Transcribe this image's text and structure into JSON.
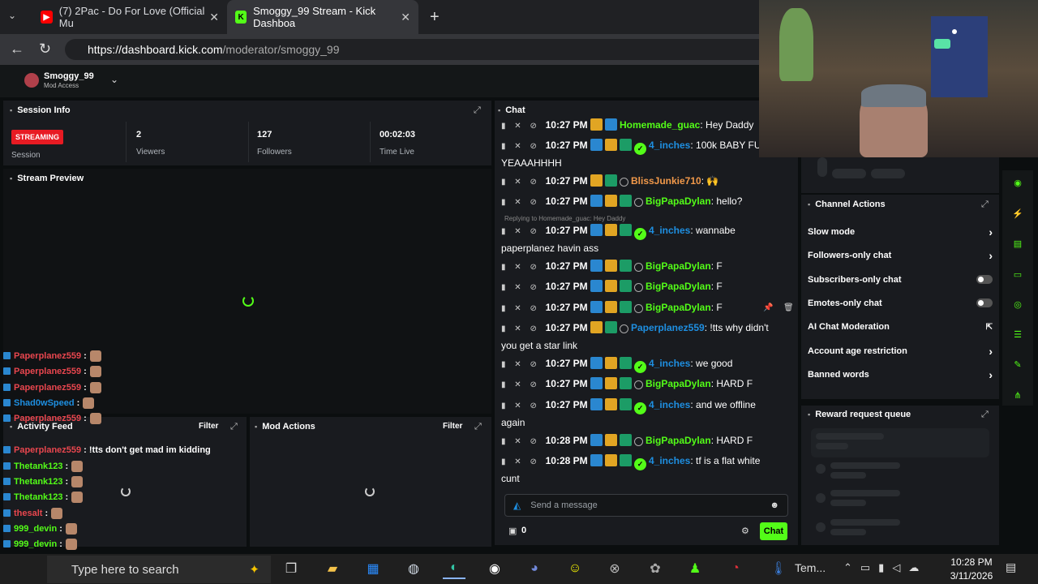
{
  "browser": {
    "tabs": [
      {
        "title": "(7) 2Pac - Do For Love (Official Mu",
        "favicon": "youtube-icon",
        "color": "#ff0000"
      },
      {
        "title": "Smoggy_99 Stream - Kick Dashboa",
        "favicon": "kick-icon",
        "color": "#53fc18"
      }
    ],
    "url_domain": "https://dashboard.kick.com",
    "url_path": "/moderator/smoggy_99"
  },
  "header": {
    "channel": "Smoggy_99",
    "access": "Mod Access"
  },
  "session": {
    "title": "Session Info",
    "status": "STREAMING",
    "status_label": "Session",
    "viewers_value": "2",
    "viewers_label": "Viewers",
    "followers_value": "127",
    "followers_label": "Followers",
    "time_value": "00:02:03",
    "time_label": "Time Live"
  },
  "preview": {
    "title": "Stream Preview"
  },
  "activity": {
    "title": "Activity Feed",
    "filter": "Filter"
  },
  "mod": {
    "title": "Mod Actions",
    "filter": "Filter"
  },
  "overlay_feed": [
    {
      "user": "Paperplanez559",
      "color": "#e8464e",
      "text": ":"
    },
    {
      "user": "Paperplanez559",
      "color": "#e8464e",
      "text": ":"
    },
    {
      "user": "Paperplanez559",
      "color": "#e8464e",
      "text": ":"
    },
    {
      "user": "Shad0wSpeed",
      "color": "#1e8fe1",
      "text": ":"
    },
    {
      "user": "Paperplanez559",
      "color": "#e8464e",
      "text": ":"
    },
    {
      "user": "Paperplanez559",
      "color": "#e8464e",
      "text": ": !tts don't get mad im kidding"
    },
    {
      "user": "Thetank123",
      "color": "#53fc18",
      "text": ":"
    },
    {
      "user": "Thetank123",
      "color": "#53fc18",
      "text": ":"
    },
    {
      "user": "Thetank123",
      "color": "#53fc18",
      "text": ":"
    },
    {
      "user": "thesalt",
      "color": "#e8464e",
      "text": ":"
    },
    {
      "user": "999_devin",
      "color": "#53fc18",
      "text": ":"
    },
    {
      "user": "999_devin",
      "color": "#53fc18",
      "text": ":"
    },
    {
      "user": "999_devin",
      "color": "#53fc18",
      "text": ":"
    },
    {
      "user": "thesalt",
      "color": "#e8464e",
      "text": ":"
    }
  ],
  "chat": {
    "title": "Chat",
    "reply_note": "Replying to Homemade_guac: Hey Daddy",
    "messages": [
      {
        "time": "10:27 PM",
        "user": "Homemade_guac",
        "color": "#53fc18",
        "text": ": Hey Daddy",
        "cont": ""
      },
      {
        "time": "10:27 PM",
        "user": "4_inches",
        "color": "#1e8fe1",
        "text": ": 100k BABY FU",
        "cont": "YEAAAHHHH"
      },
      {
        "time": "10:27 PM",
        "user": "BlissJunkie710",
        "color": "#f2994a",
        "text": ":",
        "cont": ""
      },
      {
        "time": "10:27 PM",
        "user": "BigPapaDylan",
        "color": "#53fc18",
        "text": ": hello?",
        "cont": ""
      },
      {
        "time": "10:27 PM",
        "user": "4_inches",
        "color": "#1e8fe1",
        "text": ": wannabe",
        "cont": "paperplanez havin ass"
      },
      {
        "time": "10:27 PM",
        "user": "BigPapaDylan",
        "color": "#53fc18",
        "text": ": F",
        "cont": ""
      },
      {
        "time": "10:27 PM",
        "user": "BigPapaDylan",
        "color": "#53fc18",
        "text": ": F",
        "cont": ""
      },
      {
        "time": "10:27 PM",
        "user": "BigPapaDylan",
        "color": "#53fc18",
        "text": ": F",
        "cont": ""
      },
      {
        "time": "10:27 PM",
        "user": "Paperplanez559",
        "color": "#1e8fe1",
        "text": ": !tts why didn't",
        "cont": "you get a star link"
      },
      {
        "time": "10:27 PM",
        "user": "4_inches",
        "color": "#1e8fe1",
        "text": ": we good",
        "cont": ""
      },
      {
        "time": "10:27 PM",
        "user": "BigPapaDylan",
        "color": "#53fc18",
        "text": ": HARD F",
        "cont": ""
      },
      {
        "time": "10:27 PM",
        "user": "4_inches",
        "color": "#1e8fe1",
        "text": ": and we offline",
        "cont": "again"
      },
      {
        "time": "10:28 PM",
        "user": "BigPapaDylan",
        "color": "#53fc18",
        "text": ": HARD F",
        "cont": ""
      },
      {
        "time": "10:28 PM",
        "user": "4_inches",
        "color": "#1e8fe1",
        "text": ": tf is a flat white",
        "cont": "cunt"
      }
    ],
    "input_placeholder": "Send a message",
    "counter": "0",
    "send_label": "Chat"
  },
  "channel_actions": {
    "title": "Channel Actions",
    "items": [
      {
        "label": "Slow mode",
        "kind": "chevron"
      },
      {
        "label": "Followers-only chat",
        "kind": "chevron"
      },
      {
        "label": "Subscribers-only chat",
        "kind": "toggle"
      },
      {
        "label": "Emotes-only chat",
        "kind": "toggle"
      },
      {
        "label": "AI Chat Moderation",
        "kind": "external"
      },
      {
        "label": "Account age restriction",
        "kind": "chevron"
      },
      {
        "label": "Banned words",
        "kind": "chevron"
      }
    ]
  },
  "reward": {
    "title": "Reward request queue"
  },
  "taskbar": {
    "search_placeholder": "Type here to search",
    "clock_time": "10:28 PM",
    "clock_date": "3/11/2026",
    "weather": "Tem..."
  }
}
